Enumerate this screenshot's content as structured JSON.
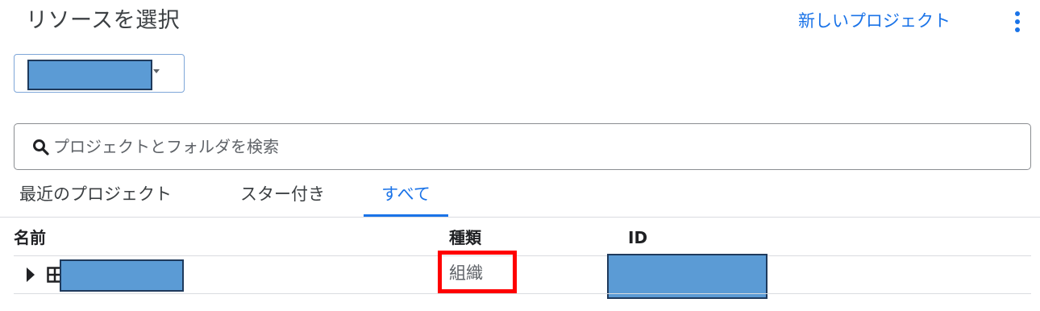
{
  "header": {
    "title": "リソースを選択",
    "new_project_label": "新しいプロジェクト",
    "more_icon": "more-vert-icon"
  },
  "org_selector": {
    "selected_value": "",
    "redacted": true
  },
  "search": {
    "placeholder": "プロジェクトとフォルダを検索",
    "value": "",
    "icon": "search-icon"
  },
  "tabs": [
    {
      "label": "最近のプロジェクト",
      "active": false
    },
    {
      "label": "スター付き",
      "active": false
    },
    {
      "label": "すべて",
      "active": true
    }
  ],
  "table": {
    "columns": [
      "名前",
      "種類",
      "ID"
    ],
    "rows": [
      {
        "name": "",
        "name_redacted": true,
        "type": "組織",
        "id": "",
        "id_redacted": true,
        "icon": "organization-icon",
        "highlighted_cell": "type"
      }
    ]
  },
  "colors": {
    "accent": "#1a73e8",
    "redaction_fill": "#5b9bd5",
    "redaction_border": "#1f3a5c",
    "highlight_border": "#ff0000"
  }
}
